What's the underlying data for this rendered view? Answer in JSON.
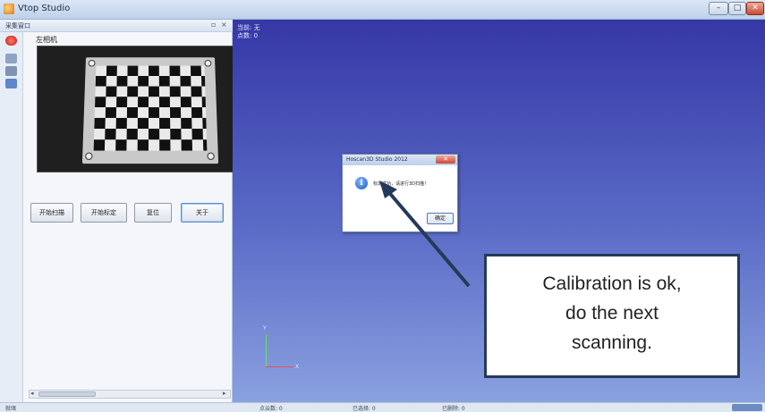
{
  "window": {
    "title": "Vtop Studio",
    "min_label": "–",
    "max_label": "□",
    "close_label": "✕"
  },
  "panel": {
    "title": "采集窗口",
    "ctrl_pin": "▫",
    "ctrl_close": "×",
    "camera_label": "左相机",
    "buttons": {
      "start_scan": "开始扫描",
      "start_calib": "开始标定",
      "reset": "复位",
      "about": "关于"
    },
    "scroll_left": "◂",
    "scroll_right": "▸"
  },
  "viewport": {
    "current_line": "当前: 无",
    "points_line": "点数: 0",
    "axis_y": "Y",
    "axis_x": "X"
  },
  "dialog": {
    "title": "Hoscan3D Studio 2012",
    "close_label": "✕",
    "icon_glyph": "i",
    "message": "标定成功，请进行3D扫描！",
    "ok_label": "确定"
  },
  "callout": {
    "line1": "Calibration is ok,",
    "line2": "do the next",
    "line3": "scanning."
  },
  "status": {
    "ready": "就绪",
    "points": "点云数: 0",
    "selected": "已选择: 0",
    "deleted": "已删除: 0"
  },
  "colors": {
    "viewport_top": "#3537a6",
    "viewport_bottom": "#8aa1df",
    "callout_border": "#253a5a",
    "arrow": "#253a5a"
  }
}
